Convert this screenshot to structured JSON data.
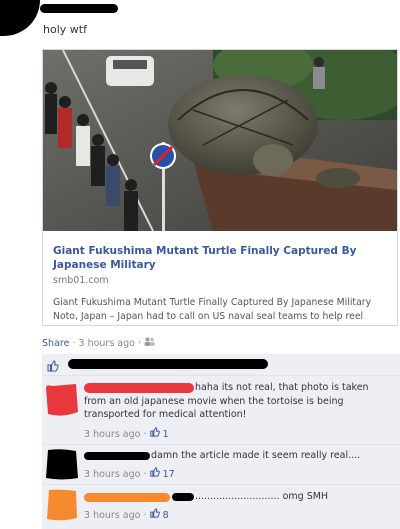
{
  "post": {
    "text": "holy wtf",
    "link": {
      "title": "Giant Fukushima Mutant Turtle Finally Captured By Japanese Military",
      "domain": "smb01.com",
      "description": "Giant Fukushima Mutant Turtle Finally Captured By Japanese Military Noto, Japan – Japan had to call on US naval seal teams to help reel"
    },
    "meta": {
      "share": "Share",
      "separator": "·",
      "time": "3 hours ago",
      "separator2": "·"
    }
  },
  "comments": [
    {
      "text_line1": "haha its not real, that photo is taken",
      "text_rest": "from an old japanese movie when the tortoise is being transported for medical attention!",
      "time": "3 hours ago",
      "sep": "·",
      "likes": "1",
      "avatar_color": "#e8383d",
      "name_color": "#e8383d"
    },
    {
      "text_line1": "damn the article made it seem really real....",
      "time": "3 hours ago",
      "sep": "·",
      "likes": "17",
      "avatar_color": "#000000",
      "name_color": "#000000"
    },
    {
      "text_line1": "............................ omg SMH",
      "time": "3 hours ago",
      "sep": "·",
      "likes": "8",
      "avatar_color": "#f7892f",
      "name_color": "#f7892f"
    }
  ],
  "colors": {
    "link_blue": "#3b5998",
    "panel_bg": "#edeff4"
  },
  "icons": {
    "like": "thumbs-up-icon",
    "people": "people-icon"
  }
}
